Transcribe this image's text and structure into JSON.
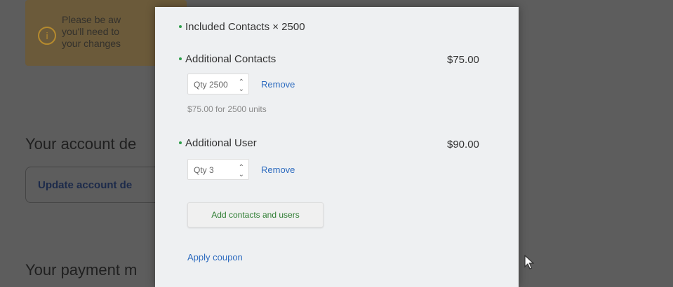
{
  "background": {
    "alert_text": "Please be aw\nyou'll need to\nyour changes",
    "account_heading": "Your account de",
    "update_button_label": "Update account de",
    "payment_heading": "Your payment m"
  },
  "modal": {
    "included": {
      "label": "Included Contacts × 2500"
    },
    "additional_contacts": {
      "label": "Additional Contacts",
      "price": "$75.00",
      "qty_label": "Qty 2500",
      "remove_label": "Remove",
      "note": "$75.00 for 2500 units"
    },
    "additional_user": {
      "label": "Additional User",
      "price": "$90.00",
      "qty_label": "Qty 3",
      "remove_label": "Remove"
    },
    "add_button_label": "Add contacts and users",
    "apply_coupon_label": "Apply coupon"
  },
  "colors": {
    "bullet": "#2e9e4a",
    "link": "#2d6bbf",
    "add_button_text": "#2e7d32"
  }
}
